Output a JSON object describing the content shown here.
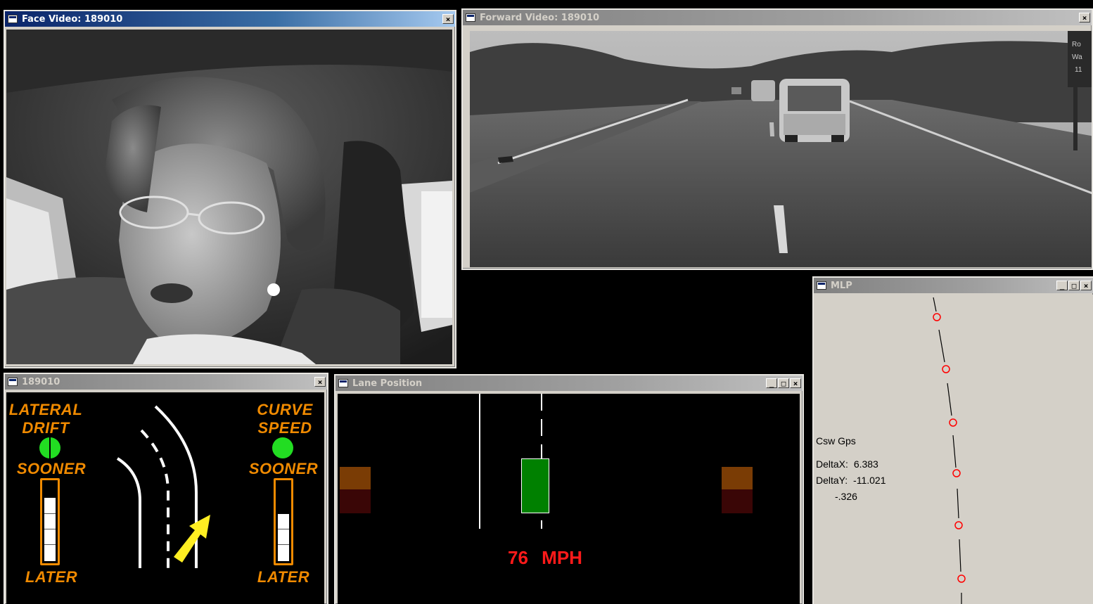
{
  "face_window": {
    "title": "Face Video: 189010",
    "close": "×"
  },
  "forward_window": {
    "title": "Forward Video: 189010",
    "close": "×",
    "sign_text": [
      "Ro",
      "Wa",
      "11"
    ]
  },
  "hud_window": {
    "title": "189010",
    "close": "×",
    "left": {
      "title_line1": "LATERAL",
      "title_line2": "DRIFT",
      "top_label": "SOONER",
      "bottom_label": "LATER",
      "indicator_color": "#22dd22",
      "level_fraction": 0.8
    },
    "right": {
      "title_line1": "CURVE",
      "title_line2": "SPEED",
      "top_label": "SOONER",
      "bottom_label": "LATER",
      "indicator_color": "#22dd22",
      "level_fraction": 0.6
    },
    "accent": "#f08a00",
    "arrow_color": "#ffee22",
    "road_icon": "curved-road-icon"
  },
  "lane_window": {
    "title": "Lane Position",
    "buttons": {
      "minimize": "_",
      "maximize": "□",
      "close": "×"
    },
    "speed": "76",
    "speed_unit": "MPH",
    "speed_color": "#ff1a1a",
    "vehicle_color": "#008000"
  },
  "mlp_window": {
    "title": "MLP",
    "buttons": {
      "minimize": "_",
      "maximize": "□",
      "close": "×"
    },
    "label": "Csw Gps",
    "delta_x_label": "DeltaX:",
    "delta_x_value": "6.383",
    "delta_y_label": "DeltaY:",
    "delta_y_value": "-11.021",
    "extra_value": "-.326",
    "marker_color": "#ff0000"
  }
}
